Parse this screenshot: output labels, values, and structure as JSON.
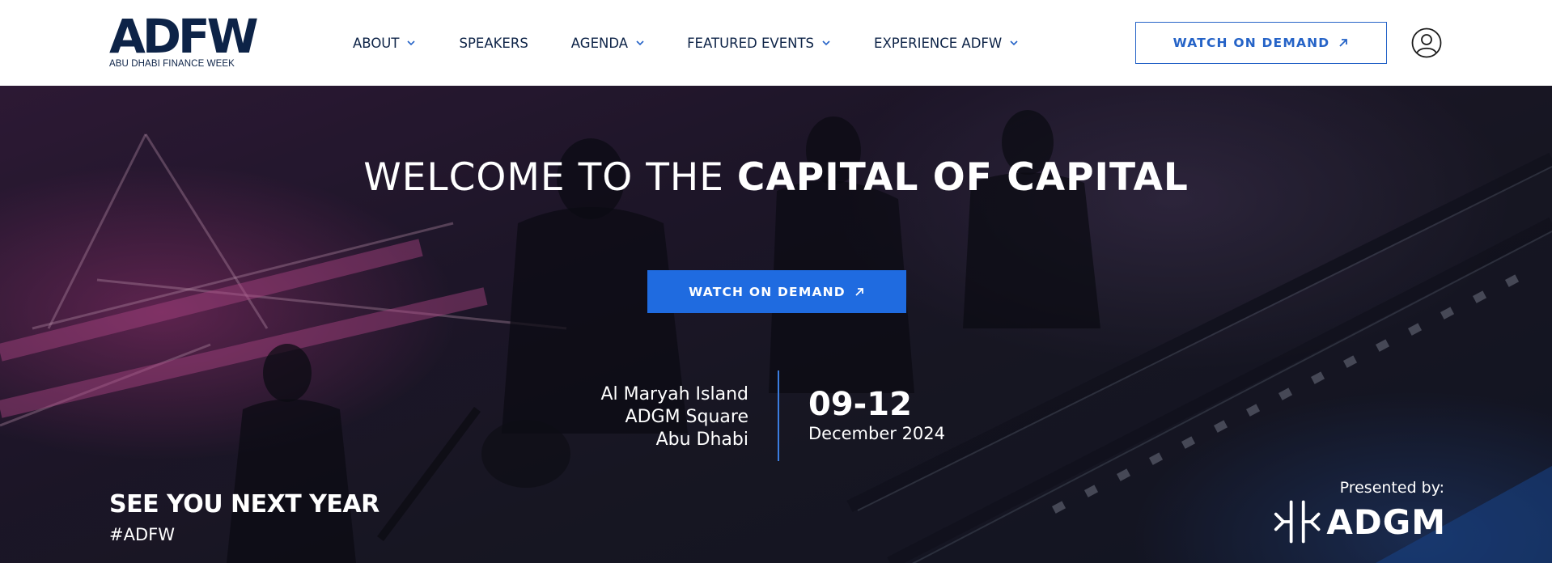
{
  "header": {
    "logo": {
      "mark": "ADFW",
      "subtitle": "ABU DHABI FINANCE WEEK"
    },
    "nav": [
      {
        "label": "ABOUT",
        "has_dropdown": true
      },
      {
        "label": "SPEAKERS",
        "has_dropdown": false
      },
      {
        "label": "AGENDA",
        "has_dropdown": true
      },
      {
        "label": "FEATURED EVENTS",
        "has_dropdown": true
      },
      {
        "label": "EXPERIENCE ADFW",
        "has_dropdown": true
      }
    ],
    "cta_label": "WATCH ON DEMAND",
    "cta_icon": "external-arrow-icon",
    "user_icon": "user-account-icon"
  },
  "hero": {
    "headline_light": "WELCOME TO THE ",
    "headline_bold": "CAPITAL OF CAPITAL",
    "cta_label": "WATCH ON DEMAND",
    "location_lines": [
      "Al Maryah Island",
      "ADGM Square",
      "Abu Dhabi"
    ],
    "date_range": "09-12",
    "date_month": "December 2024",
    "see_you": "SEE YOU NEXT YEAR",
    "hashtag": "#ADFW",
    "presented_by": "Presented by:",
    "sponsor_name": "ADGM"
  },
  "colors": {
    "navy": "#0d2347",
    "accent_blue": "#1f6be0",
    "outline_blue": "#2563c7",
    "divider_blue": "#3b7de0",
    "white": "#ffffff"
  }
}
